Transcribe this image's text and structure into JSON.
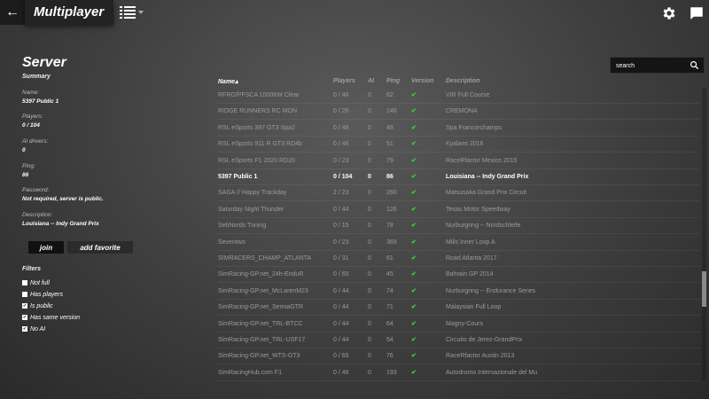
{
  "header": {
    "back_icon": "arrow-left-icon",
    "title": "Multiplayer",
    "view_icon": "list-view-icon",
    "settings_icon": "gear-icon",
    "chat_icon": "chat-icon"
  },
  "server": {
    "title": "Server",
    "summary_label": "Summary",
    "fields": [
      {
        "label": "Name:",
        "value": "5397 Public 1"
      },
      {
        "label": "Players:",
        "value": "0 / 104"
      },
      {
        "label": "AI drivers:",
        "value": "0"
      },
      {
        "label": "Ping:",
        "value": "86"
      },
      {
        "label": "Password:",
        "value": "Not required, server is public."
      },
      {
        "label": "Description:",
        "value": "Louisiana -- Indy Grand Prix"
      }
    ],
    "join_label": "join",
    "add_favorite_label": "add favorite"
  },
  "filters": {
    "title": "Filters",
    "items": [
      {
        "label": "Not full",
        "checked": false
      },
      {
        "label": "Has players",
        "checked": false
      },
      {
        "label": "Is public",
        "checked": true
      },
      {
        "label": "Has same version",
        "checked": true
      },
      {
        "label": "No AI",
        "checked": true
      }
    ]
  },
  "search": {
    "placeholder": "search"
  },
  "table": {
    "columns": [
      "Name",
      "Players",
      "AI",
      "Ping",
      "Version",
      "Description"
    ],
    "sort_column": "Name",
    "rows": [
      {
        "name": "RFRO/PFSCA 1000KM Clear",
        "players": "0 / 46",
        "ai": "0",
        "ping": "62",
        "version": "ok",
        "desc": "VIR Full Course"
      },
      {
        "name": "RIDGE RUNNERS RC MON",
        "players": "0 / 26",
        "ai": "0",
        "ping": "146",
        "version": "ok",
        "desc": "CREMONA"
      },
      {
        "name": "RSL eSports 397 GT3 Spa2",
        "players": "0 / 46",
        "ai": "0",
        "ping": "48",
        "version": "ok",
        "desc": "Spa Francorchamps"
      },
      {
        "name": "RSL eSports 911 R GT3 RD4b",
        "players": "0 / 46",
        "ai": "0",
        "ping": "51",
        "version": "ok",
        "desc": "Kyalami 2016"
      },
      {
        "name": "RSL eSports F1 2020 RD20",
        "players": "0 / 23",
        "ai": "0",
        "ping": "79",
        "version": "ok",
        "desc": "RaceRfactor Mexico 2015"
      },
      {
        "name": "5397 Public 1",
        "players": "0 / 104",
        "ai": "0",
        "ping": "86",
        "version": "ok",
        "desc": "Louisiana -- Indy Grand Prix",
        "selected": true
      },
      {
        "name": "SAGA // Happy Trackday",
        "players": "2 / 23",
        "ai": "0",
        "ping": "260",
        "version": "ok",
        "desc": "Matsusaka Grand Prix Circuit"
      },
      {
        "name": "Saturday Night Thunder",
        "players": "0 / 44",
        "ai": "0",
        "ping": "126",
        "version": "ok",
        "desc": "Texas Motor Speedway"
      },
      {
        "name": "SebNords Tuning",
        "players": "0 / 15",
        "ai": "0",
        "ping": "78",
        "version": "ok",
        "desc": "Nurburgring -- Nordschleife"
      },
      {
        "name": "Seventwo",
        "players": "0 / 23",
        "ai": "0",
        "ping": "369",
        "version": "ok",
        "desc": "Mills Inner Loop A"
      },
      {
        "name": "SIMRACERS_CHAMP_ATLANTA",
        "players": "0 / 31",
        "ai": "0",
        "ping": "61",
        "version": "ok",
        "desc": "Road Atlanta 2017"
      },
      {
        "name": "SimRacing-GP.net_24h-EnduR",
        "players": "0 / 65",
        "ai": "0",
        "ping": "45",
        "version": "ok",
        "desc": "Bahrain GP 2014"
      },
      {
        "name": "SimRacing-GP.net_McLarenM23",
        "players": "0 / 44",
        "ai": "0",
        "ping": "74",
        "version": "ok",
        "desc": "Nurburgring -- Endurance Series"
      },
      {
        "name": "SimRacing-GP.net_SennaGTR",
        "players": "0 / 44",
        "ai": "0",
        "ping": "71",
        "version": "ok",
        "desc": "Malaysian Full Loop"
      },
      {
        "name": "SimRacing-GP.net_TRL-BTCC",
        "players": "0 / 44",
        "ai": "0",
        "ping": "64",
        "version": "ok",
        "desc": "Magny-Cours"
      },
      {
        "name": "SimRacing-GP.net_TRL-USF17",
        "players": "0 / 44",
        "ai": "0",
        "ping": "54",
        "version": "ok",
        "desc": "Circuito de Jerez-GrandPrix"
      },
      {
        "name": "SimRacing-GP.net_WTS-GT3",
        "players": "0 / 65",
        "ai": "0",
        "ping": "76",
        "version": "ok",
        "desc": "RaceRfactor Austin 2013"
      },
      {
        "name": "SimRacingHub.com F1",
        "players": "0 / 46",
        "ai": "0",
        "ping": "193",
        "version": "ok",
        "desc": "Autodromo Internazionale del Mu"
      }
    ]
  },
  "colors": {
    "accent_check": "#4cc84c"
  }
}
